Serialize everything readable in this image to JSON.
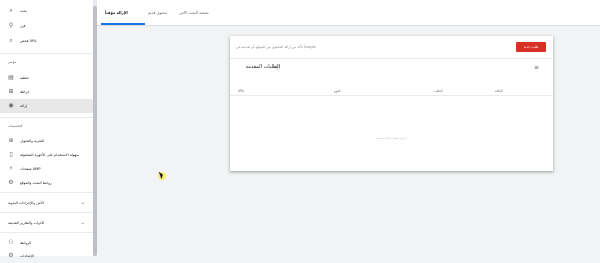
{
  "sidebar": {
    "top_items": [
      {
        "label": "بحث",
        "icon": "search-icon"
      },
      {
        "label": "فرز",
        "icon": "filter-icon"
      },
      {
        "label": "فحص URL",
        "icon": "magnify-url-icon"
      }
    ],
    "section1": {
      "title": "مؤشر",
      "items": [
        {
          "label": "تغطية",
          "icon": "coverage-icon"
        },
        {
          "label": "خرائط",
          "icon": "sitemap-icon"
        },
        {
          "label": "إزالة",
          "icon": "removal-icon",
          "active": true
        }
      ]
    },
    "section2": {
      "title": "التحسينات",
      "items": [
        {
          "label": "التجربة والتحويل",
          "icon": "experience-icon"
        },
        {
          "label": "سهولة الاستخدام على الأجهزة المحمولة",
          "icon": "mobile-icon"
        },
        {
          "label": "صفحات AMP",
          "icon": "amp-icon"
        },
        {
          "label": "روابط البحث والموقع",
          "icon": "links-icon"
        }
      ]
    },
    "collapsibles": [
      {
        "label": "الأمن والإجراءات اليدوية"
      },
      {
        "label": "الأدوات والتقارير القديمة"
      }
    ],
    "bottom_items": [
      {
        "label": "الروابط",
        "icon": "link-icon"
      },
      {
        "label": "الإعدادات",
        "icon": "settings-icon"
      }
    ]
  },
  "tabs": [
    {
      "label": "الإزالة مؤقتاً",
      "active": true
    },
    {
      "label": "محتوى قديم",
      "active": false
    },
    {
      "label": "تصفية البحث الآمن",
      "active": false
    }
  ],
  "card": {
    "request_button": "طلب جديد",
    "url_placeholder": "تأكد من إزالة المحتوى من الموقع، أو تحديثه في Google",
    "title": "الطلبات المقدمة",
    "columns": [
      "URL",
      "النوع",
      "الطلب",
      "الحالة"
    ],
    "empty_message": "لا توجد طلبات إزالة مقدمة"
  }
}
